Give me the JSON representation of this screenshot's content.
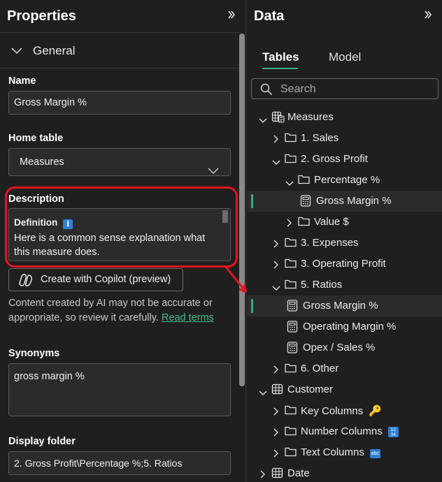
{
  "properties": {
    "title": "Properties",
    "section": "General",
    "name_label": "Name",
    "name_value": "Gross Margin %",
    "home_table_label": "Home table",
    "home_table_value": "Measures",
    "description_label": "Description",
    "description_heading": "Definition",
    "description_info_glyph": "i",
    "description_text": "Here is a common sense explanation what this measure does.",
    "copilot_button": "Create with Copilot (preview)",
    "ai_disclaimer": "Content created by AI may not be accurate or appropriate, so review it carefully.",
    "read_terms": "Read terms",
    "synonyms_label": "Synonyms",
    "synonyms_value": "gross margin %",
    "display_folder_label": "Display folder",
    "display_folder_value": "2. Gross Profit\\Percentage %;5. Ratios",
    "collapse_icon": "chevron-right-double-icon"
  },
  "data_pane": {
    "title": "Data",
    "tabs": [
      "Tables",
      "Model"
    ],
    "active_tab": "Tables",
    "search_placeholder": "Search",
    "accent_color": "#3aa987",
    "highlight_color": "#e2141e",
    "tree": [
      {
        "label": "Measures",
        "icon": "measure-table-icon",
        "expanded": true
      },
      {
        "label": "1. Sales",
        "icon": "folder-icon",
        "expanded": false
      },
      {
        "label": "2. Gross Profit",
        "icon": "folder-icon",
        "expanded": true
      },
      {
        "label": "Percentage %",
        "icon": "folder-icon",
        "expanded": true
      },
      {
        "label": "Gross Margin %",
        "icon": "measure-icon",
        "selected": true
      },
      {
        "label": "Value $",
        "icon": "folder-icon",
        "expanded": false
      },
      {
        "label": "3. Expenses",
        "icon": "folder-icon",
        "expanded": false
      },
      {
        "label": "3. Operating Profit",
        "icon": "folder-icon",
        "expanded": false
      },
      {
        "label": "5. Ratios",
        "icon": "folder-icon",
        "expanded": true
      },
      {
        "label": "Gross Margin %",
        "icon": "measure-icon",
        "selected": true
      },
      {
        "label": "Operating Margin %",
        "icon": "measure-icon"
      },
      {
        "label": "Opex / Sales %",
        "icon": "measure-icon"
      },
      {
        "label": "6. Other",
        "icon": "folder-icon",
        "expanded": false
      },
      {
        "label": "Customer",
        "icon": "table-icon",
        "expanded": true
      },
      {
        "label": "Key Columns",
        "icon": "folder-icon",
        "expanded": false,
        "suffix": "🔑"
      },
      {
        "label": "Number Columns",
        "icon": "folder-icon",
        "expanded": false,
        "badge": "1234"
      },
      {
        "label": "Text Columns",
        "icon": "folder-icon",
        "expanded": false,
        "badge": "abc"
      },
      {
        "label": "Date",
        "icon": "table-icon",
        "expanded": false
      }
    ]
  }
}
